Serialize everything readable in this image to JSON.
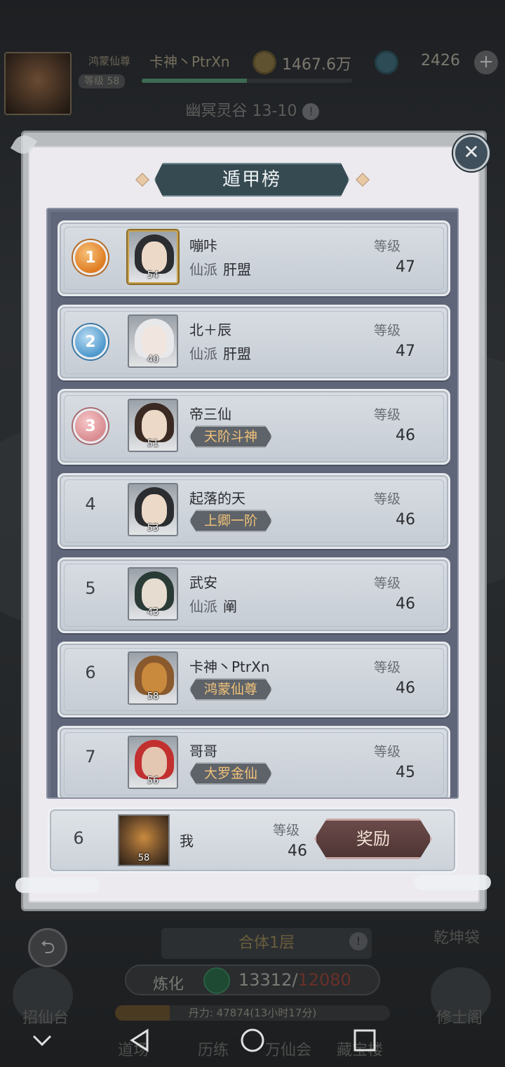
{
  "topbar": {
    "title_label": "鸿蒙仙尊",
    "player_name": "卡神丶PtrXn",
    "level_label": "等级 58",
    "level_progress": 0.5,
    "coins": "1467.6万",
    "gems": "2426",
    "plus": "+"
  },
  "stage": {
    "name": "幽冥灵谷 13-10",
    "warn": "!"
  },
  "dialog": {
    "title": "遁甲榜",
    "close": "✕",
    "rows": [
      {
        "rank": "1",
        "medal": "gold",
        "name": "嘣咔",
        "sect_label": "仙派",
        "sect": "肝盟",
        "title": "",
        "portrait_level": "54",
        "level_label": "等级",
        "level": "47"
      },
      {
        "rank": "2",
        "medal": "silver",
        "name": "北＋辰",
        "sect_label": "仙派",
        "sect": "肝盟",
        "title": "",
        "portrait_level": "40",
        "level_label": "等级",
        "level": "47"
      },
      {
        "rank": "3",
        "medal": "bronze",
        "name": "帝三仙",
        "sect_label": "",
        "sect": "",
        "title": "天阶斗神",
        "portrait_level": "51",
        "level_label": "等级",
        "level": "46"
      },
      {
        "rank": "4",
        "medal": "",
        "name": "起落的天",
        "sect_label": "",
        "sect": "",
        "title": "上卿一阶",
        "portrait_level": "53",
        "level_label": "等级",
        "level": "46"
      },
      {
        "rank": "5",
        "medal": "",
        "name": "武安",
        "sect_label": "仙派",
        "sect": "阐",
        "title": "",
        "portrait_level": "43",
        "level_label": "等级",
        "level": "46"
      },
      {
        "rank": "6",
        "medal": "",
        "name": "卡神丶PtrXn",
        "sect_label": "",
        "sect": "",
        "title": "鸿蒙仙尊",
        "portrait_level": "58",
        "level_label": "等级",
        "level": "46"
      },
      {
        "rank": "7",
        "medal": "",
        "name": "哥哥",
        "sect_label": "",
        "sect": "",
        "title": "大罗金仙",
        "portrait_level": "56",
        "level_label": "等级",
        "level": "45"
      }
    ],
    "me": {
      "rank": "6",
      "name": "我",
      "portrait_level": "58",
      "level_label": "等级",
      "level": "46",
      "reward_button": "奖励"
    }
  },
  "bottom": {
    "layer": "合体1层",
    "layer_warn": "!",
    "refine_label": "炼化",
    "refine_current": "13312/",
    "refine_max": "12080",
    "pill_power": "丹力: 47874(13小时17分)",
    "pill_progress": 0.2,
    "left_label": "招仙台",
    "right_top_label": "乾坤袋",
    "right_label": "修士阁",
    "tabs": [
      "道场",
      "历练",
      "万仙会",
      "藏宝楼"
    ]
  },
  "colors": {
    "accent": "#364a52",
    "gold_title": "#f1c278",
    "reward": "#4e3534"
  }
}
